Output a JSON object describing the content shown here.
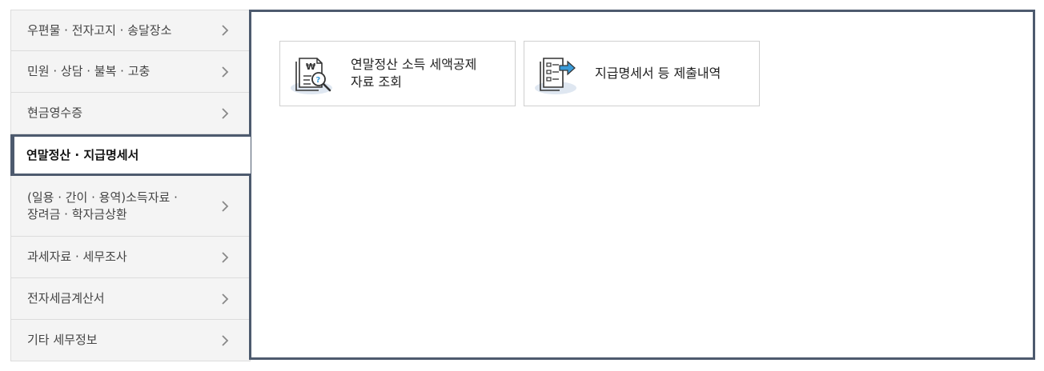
{
  "sidebar": {
    "items": [
      {
        "label": "우편물 · 전자고지 · 송달장소"
      },
      {
        "label": "민원 · 상담 · 불복 · 고충"
      },
      {
        "label": "현금영수증"
      },
      {
        "label": "연말정산 · 지급명세서",
        "active": true
      },
      {
        "label_line1": "(일용 · 간이 · 용역)소득자료 ·",
        "label_line2": "장려금 · 학자금상환"
      },
      {
        "label": "과세자료 · 세무조사"
      },
      {
        "label": "전자세금계산서"
      },
      {
        "label": "기타 세무정보"
      }
    ]
  },
  "content": {
    "cards": [
      {
        "label_line1": "연말정산 소득 세액공제",
        "label_line2": "자료 조회",
        "icon": "document-search-icon"
      },
      {
        "label": "지급명세서 등 제출내역",
        "icon": "document-submit-icon"
      }
    ]
  },
  "colors": {
    "accent_border": "#4d5a6e",
    "menu_bg": "#f4f4f4",
    "icon_blue": "#3b9bd8",
    "icon_bg": "#dfe7f1"
  }
}
